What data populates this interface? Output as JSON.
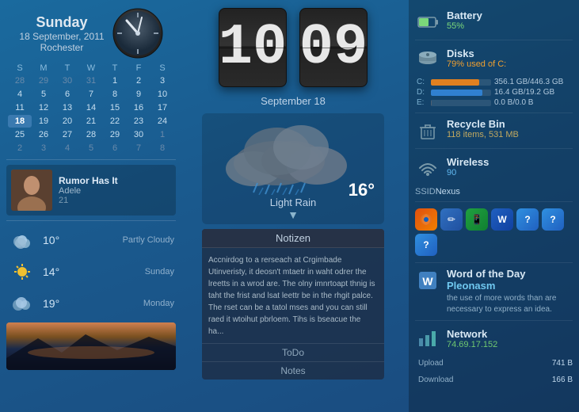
{
  "left": {
    "day_name": "Sunday",
    "date_full": "18 September, 2011",
    "city": "Rochester",
    "calendar": {
      "headers": [
        "S",
        "M",
        "T",
        "W",
        "T",
        "F",
        "S"
      ],
      "rows": [
        [
          "28",
          "29",
          "30",
          "31",
          "1",
          "2",
          "3"
        ],
        [
          "4",
          "5",
          "6",
          "7",
          "8",
          "9",
          "10"
        ],
        [
          "11",
          "12",
          "13",
          "14",
          "15",
          "16",
          "17"
        ],
        [
          "18",
          "19",
          "20",
          "21",
          "22",
          "23",
          "24"
        ],
        [
          "25",
          "26",
          "27",
          "28",
          "29",
          "30",
          "1"
        ],
        [
          "2",
          "3",
          "4",
          "5",
          "6",
          "7",
          "8"
        ]
      ],
      "today_index": "18",
      "other_month_start": [
        "28",
        "29",
        "30",
        "31"
      ],
      "other_month_end": [
        "1",
        "2",
        "3",
        "4",
        "5",
        "6",
        "7",
        "8"
      ]
    },
    "track": {
      "title": "Rumor Has It",
      "artist": "Adele",
      "number": "21"
    },
    "weather": [
      {
        "temp": "10°",
        "desc": "Partly Cloudy"
      },
      {
        "temp": "14°",
        "desc": "Sunday"
      },
      {
        "temp": "19°",
        "desc": "Monday"
      }
    ]
  },
  "middle": {
    "clock": {
      "hour": "10",
      "minute": "09",
      "date_label": "September  18"
    },
    "weather": {
      "temp": "16°",
      "condition": "Light Rain",
      "arrow": "▼"
    },
    "notes": {
      "header": "Notizen",
      "body": "Accnirdog to a rerseach at Crgimbade Utinveristy, it deosn't mtaetr in waht odrer the lreetts in a wrod are. The olny imnrtoapt thnig is taht the frist and lsat leettr be in the rhgit palce.\n\nThe rset can be a tatol mses and you can still raed it wtoihut pbrloem. Tihs is bseacue the ha...",
      "todo_label": "ToDo",
      "notes_label": "Notes"
    }
  },
  "right": {
    "battery": {
      "title": "Battery",
      "value": "55%",
      "percent": 55,
      "color": "#7ad87a"
    },
    "disks": {
      "title": "Disks",
      "subtitle": "79% used of C:",
      "drives": [
        {
          "label": "C:",
          "used": "356.1 GB",
          "total": "446.3 GB",
          "percent": 80
        },
        {
          "label": "D:",
          "used": "16.4 GB",
          "total": "19.2 GB",
          "percent": 85
        },
        {
          "label": "E:",
          "used": "0.0 B",
          "total": "0.0 B",
          "percent": 0
        }
      ]
    },
    "recycle_bin": {
      "title": "Recycle Bin",
      "subtitle": "118  items, 531 MB"
    },
    "wireless": {
      "title": "Wireless",
      "signal": 90,
      "ssid_label": "SSID",
      "ssid_value": "Nexus"
    },
    "app_icons": [
      "🦊",
      "✏️",
      "📱",
      "W",
      "?",
      "?",
      "?"
    ],
    "word_of_day": {
      "title": "Word of the Day",
      "word": "Pleonasm",
      "definition": "the use of more words than are necessary to express an idea."
    },
    "network": {
      "title": "Network",
      "ip": "74.69.17.152",
      "upload_label": "Upload",
      "upload_value": "741 B",
      "download_label": "Download",
      "download_value": "166 B"
    }
  }
}
